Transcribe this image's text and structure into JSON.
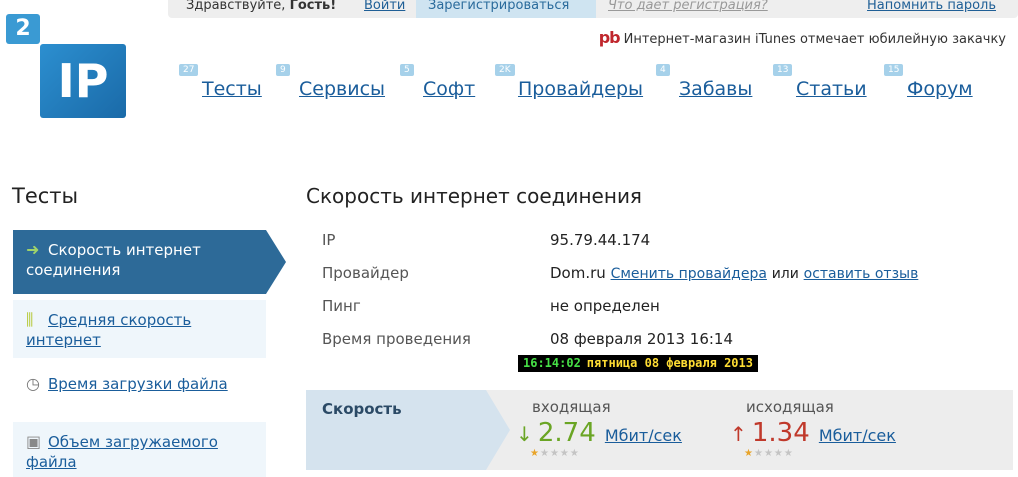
{
  "topbar": {
    "greeting_prefix": "Здравствуйте, ",
    "greeting_name": "Гость!",
    "login": "Войти",
    "register": "Зарегистрироваться",
    "why_register": "Что дает регистрация?",
    "remind_password": "Напомнить пароль"
  },
  "logo": {
    "small": "2",
    "big": "IP"
  },
  "news": {
    "text": "Интернет-магазин iTunes отмечает юбилейную закачку"
  },
  "nav": [
    {
      "label": "Тесты",
      "badge": "27"
    },
    {
      "label": "Сервисы",
      "badge": "9"
    },
    {
      "label": "Софт",
      "badge": "5"
    },
    {
      "label": "Провайдеры",
      "badge": "2K"
    },
    {
      "label": "Забавы",
      "badge": "4"
    },
    {
      "label": "Статьи",
      "badge": "13"
    },
    {
      "label": "Форум",
      "badge": "15"
    }
  ],
  "sidebar": {
    "title": "Тесты",
    "items": [
      {
        "label": "Скорость интернет соединения",
        "icon": "refresh-arrow-icon"
      },
      {
        "label": "Средняя скорость интернет",
        "icon": "bars-icon"
      },
      {
        "label": "Время загрузки файла",
        "icon": "clock-icon"
      },
      {
        "label": "Объем загружаемого файла",
        "icon": "box-icon"
      }
    ]
  },
  "main": {
    "title": "Скорость интернет соединения",
    "rows": {
      "ip_label": "IP",
      "ip_value": "95.79.44.174",
      "provider_label": "Провайдер",
      "provider_value": "Dom.ru",
      "change_provider": "Сменить провайдера",
      "or": "или",
      "leave_review": "оставить отзыв",
      "ping_label": "Пинг",
      "ping_value": "не определен",
      "time_label": "Время проведения",
      "time_value": "08 февраля 2013 16:14"
    },
    "clock": {
      "time": "16:14:02",
      "date": "пятница 08 февраля 2013"
    }
  },
  "speed": {
    "label": "Скорость",
    "incoming": {
      "name": "входящая",
      "arrow": "↓",
      "value": "2.74",
      "unit": "Мбит/сек",
      "rating": 1
    },
    "outgoing": {
      "name": "исходящая",
      "arrow": "↑",
      "value": "1.34",
      "unit": "Мбит/сек",
      "rating": 1
    },
    "rating_max": 5
  },
  "colors": {
    "accent": "#2d6a98",
    "link": "#1a5d9b",
    "incoming": "#6aa524",
    "outgoing": "#c0392b"
  }
}
